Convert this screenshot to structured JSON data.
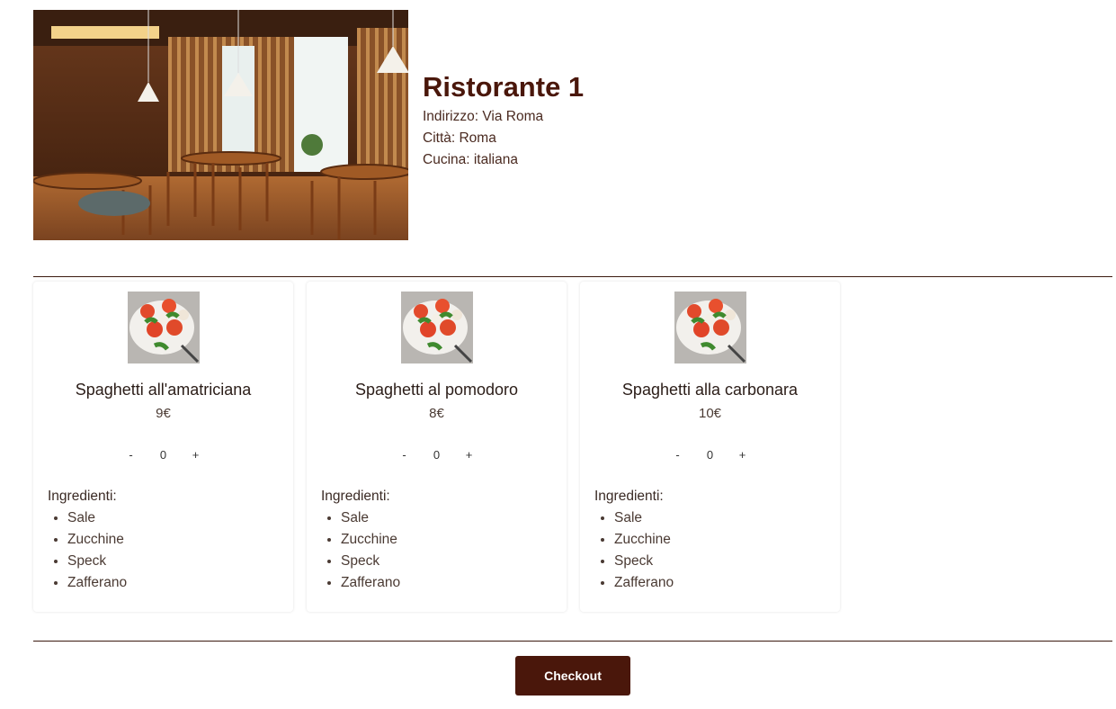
{
  "restaurant": {
    "name": "Ristorante 1",
    "address": "Indirizzo: Via Roma",
    "city": "Città: Roma",
    "cuisine": "Cucina: italiana"
  },
  "dishes": [
    {
      "name": "Spaghetti all'amatriciana",
      "price": "9€",
      "minus": "-",
      "quantity": "0",
      "plus": "+",
      "ingredients_title": "Ingredienti:",
      "ingredients": [
        "Sale",
        "Zucchine",
        "Speck",
        "Zafferano"
      ]
    },
    {
      "name": "Spaghetti al pomodoro",
      "price": "8€",
      "minus": "-",
      "quantity": "0",
      "plus": "+",
      "ingredients_title": "Ingredienti:",
      "ingredients": [
        "Sale",
        "Zucchine",
        "Speck",
        "Zafferano"
      ]
    },
    {
      "name": "Spaghetti alla carbonara",
      "price": "10€",
      "minus": "-",
      "quantity": "0",
      "plus": "+",
      "ingredients_title": "Ingredienti:",
      "ingredients": [
        "Sale",
        "Zucchine",
        "Speck",
        "Zafferano"
      ]
    }
  ],
  "checkout_label": "Checkout",
  "colors": {
    "brand": "#4a170b",
    "divider": "#3b1a10"
  }
}
